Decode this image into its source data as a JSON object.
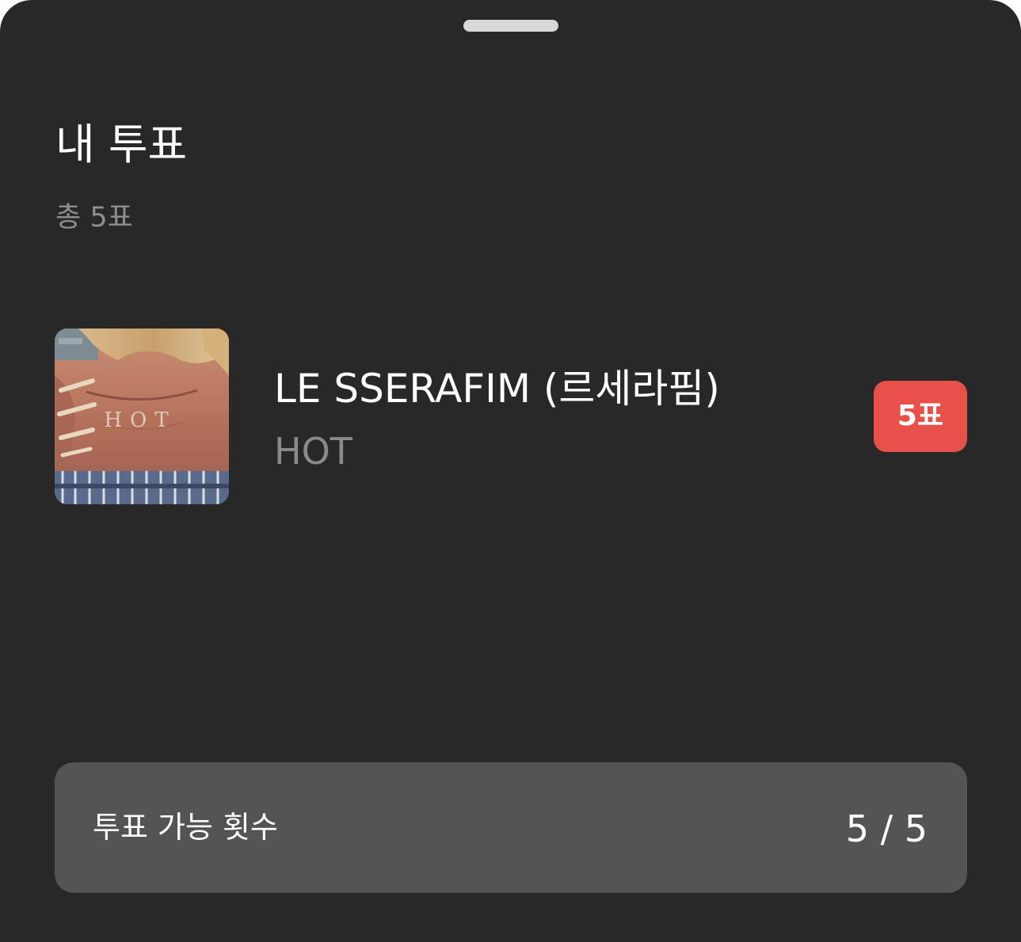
{
  "sheet": {
    "title": "내 투표",
    "subtitle": "총 5표"
  },
  "vote_item": {
    "album_art_icon": "album-cover-image",
    "album_art_text": "HOT",
    "artist": "LE SSERAFIM (르세라핌)",
    "song": "HOT",
    "votes_badge": "5표"
  },
  "vote_summary": {
    "label": "투표 가능 횟수",
    "value": "5 / 5"
  },
  "colors": {
    "background": "#282828",
    "badge": "#e8504a",
    "summary_box": "#545454",
    "muted_text": "#8e8e8e"
  }
}
